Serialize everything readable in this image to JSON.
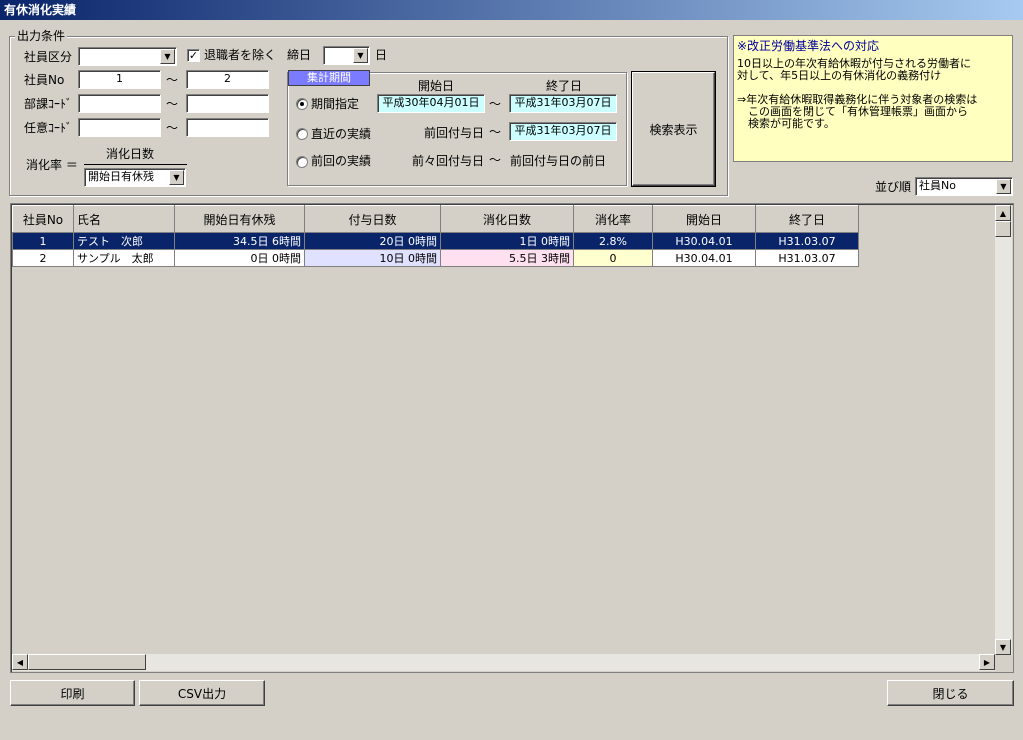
{
  "window": {
    "title": "有休消化実績"
  },
  "conditions": {
    "legend": "出力条件",
    "employee_class_label": "社員区分",
    "employee_class_value": "",
    "exclude_retired_label": "退職者を除く",
    "exclude_retired_checked": "✓",
    "closing_day_label": "締日",
    "closing_day_value": "",
    "closing_day_unit": "日",
    "employee_no_label": "社員No",
    "employee_no_from": "1",
    "employee_no_to": "2",
    "dept_code_label": "部課ｺｰﾄﾞ",
    "dept_code_from": "",
    "dept_code_to": "",
    "any_code_label": "任意ｺｰﾄﾞ",
    "any_code_from": "",
    "any_code_to": "",
    "tilde": "～",
    "rate_label": "消化率 ＝",
    "rate_numerator": "消化日数",
    "rate_denominator": "開始日有休残"
  },
  "period": {
    "legend": "集計期間",
    "start_header": "開始日",
    "end_header": "終了日",
    "option1_label": "期間指定",
    "option1_start": "平成30年04月01日",
    "option1_end": "平成31年03月07日",
    "option2_label": "直近の実績",
    "option2_start_label": "前回付与日",
    "option2_end": "平成31年03月07日",
    "option3_label": "前回の実績",
    "option3_start_label": "前々回付与日",
    "option3_end_label": "前回付与日の前日",
    "tilde": "～"
  },
  "search_button": "検索表示",
  "note": {
    "title": "※改正労働基準法への対応",
    "line1": "10日以上の年次有給休暇が付与される労働者に",
    "line2": "対して、年5日以上の有休消化の義務付け",
    "line3": "⇒年次有給休暇取得義務化に伴う対象者の検索は",
    "line4": "　この画面を閉じて「有休管理帳票」画面から",
    "line5": "　検索が可能です。"
  },
  "sort": {
    "label": "並び順",
    "value": "社員No"
  },
  "table": {
    "headers": [
      "社員No",
      "氏名",
      "開始日有休残",
      "付与日数",
      "消化日数",
      "消化率",
      "開始日",
      "終了日"
    ],
    "rows": [
      [
        "1",
        "テスト　次郎",
        "34.5日 6時間",
        "20日 0時間",
        "1日 0時間",
        "2.8%",
        "H30.04.01",
        "H31.03.07"
      ],
      [
        "2",
        "サンプル　太郎",
        "0日 0時間",
        "10日 0時間",
        "5.5日 3時間",
        "0",
        "H30.04.01",
        "H31.03.07"
      ]
    ]
  },
  "footer": {
    "print": "印刷",
    "csv": "CSV出力",
    "close": "閉じる"
  },
  "colors": {
    "selected_row": "#0a246a",
    "granted_cell": "#e0e0ff",
    "consumed_cell": "#ffe0f0",
    "rate_cell": "#ffffd0"
  }
}
